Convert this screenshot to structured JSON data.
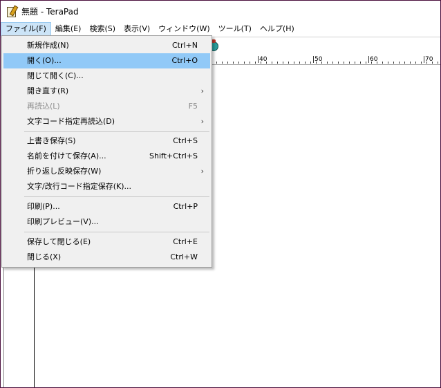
{
  "window": {
    "title": "無題 - TeraPad"
  },
  "menubar": {
    "items": [
      {
        "label": "ファイル(F)"
      },
      {
        "label": "編集(E)"
      },
      {
        "label": "検索(S)"
      },
      {
        "label": "表示(V)"
      },
      {
        "label": "ウィンドウ(W)"
      },
      {
        "label": "ツール(T)"
      },
      {
        "label": "ヘルプ(H)"
      }
    ]
  },
  "ruler": {
    "labels": [
      "40",
      "50",
      "60",
      "70"
    ]
  },
  "file_menu": {
    "items": [
      {
        "label": "新規作成(N)",
        "shortcut": "Ctrl+N"
      },
      {
        "label": "開く(O)...",
        "shortcut": "Ctrl+O"
      },
      {
        "label": "閉じて開く(C)...",
        "shortcut": ""
      },
      {
        "label": "開き直す(R)",
        "shortcut": ""
      },
      {
        "label": "再読込(L)",
        "shortcut": "F5"
      },
      {
        "label": "文字コード指定再読込(D)",
        "shortcut": ""
      },
      {
        "label": "上書き保存(S)",
        "shortcut": "Ctrl+S"
      },
      {
        "label": "名前を付けて保存(A)...",
        "shortcut": "Shift+Ctrl+S"
      },
      {
        "label": "折り返し反映保存(W)",
        "shortcut": ""
      },
      {
        "label": "文字/改行コード指定保存(K)...",
        "shortcut": ""
      },
      {
        "label": "印刷(P)...",
        "shortcut": "Ctrl+P"
      },
      {
        "label": "印刷プレビュー(V)...",
        "shortcut": ""
      },
      {
        "label": "保存して閉じる(E)",
        "shortcut": "Ctrl+E"
      },
      {
        "label": "閉じる(X)",
        "shortcut": "Ctrl+W"
      }
    ]
  }
}
